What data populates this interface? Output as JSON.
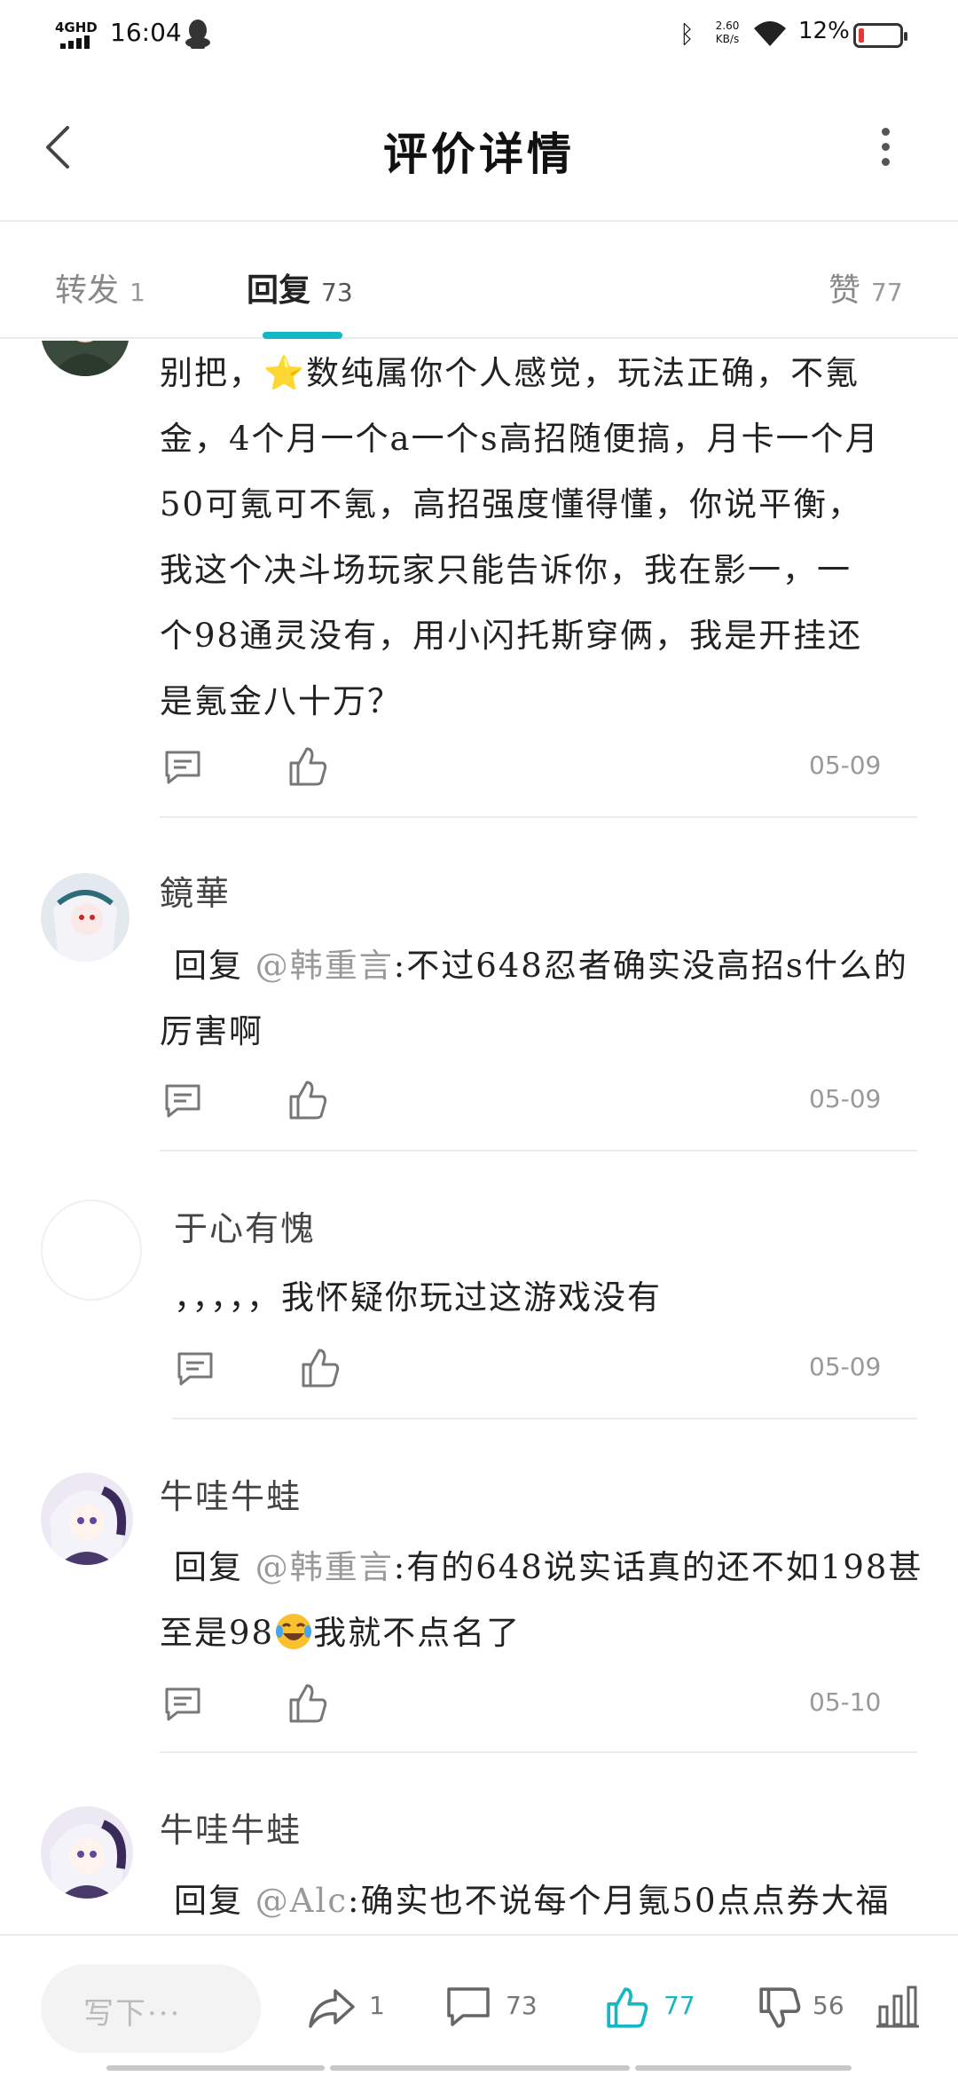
{
  "status_bar": {
    "network": "4GHD",
    "time": "16:04",
    "speed_value": "2.60",
    "speed_unit": "KB/s",
    "battery": "12%"
  },
  "header": {
    "title": "评价详情"
  },
  "tabs": [
    {
      "label": "转发",
      "count": "1"
    },
    {
      "label": "回复",
      "count": "73"
    },
    {
      "label": "赞",
      "count": "77"
    }
  ],
  "comments": [
    {
      "lines": [
        "别把，⭐数纯属你个人感觉，玩法正确，不氪",
        "金，4个月一个a一个s高招随便搞，月卡一个月",
        "50可氪可不氪，高招强度懂得懂，你说平衡，",
        "我这个决斗场玩家只能告诉你，我在影一，一",
        "个98通灵没有，用小闪托斯穿俩，我是开挂还",
        "是氪金八十万？"
      ],
      "date": "05-09"
    },
    {
      "name": "鏡華",
      "reply_prefix": "回复",
      "mention": "@韩重言",
      "lines": [
        ":不过648忍者确实没高招s什么的",
        "厉害啊"
      ],
      "date": "05-09"
    },
    {
      "name": "于心有愧",
      "lines": [
        "，，，，，我怀疑你玩过这游戏没有"
      ],
      "date": "05-09"
    },
    {
      "name": "牛哇牛蛙",
      "reply_prefix": "回复",
      "mention": "@韩重言",
      "lines": [
        ":有的648说实话真的还不如198甚",
        "至是98",
        "我就不点名了"
      ],
      "date": "05-10"
    },
    {
      "name": "牛哇牛蛙",
      "reply_prefix": "回复",
      "mention": "@Alc",
      "lines": [
        ":确实也不说每个月氪50点点券大福"
      ]
    }
  ],
  "bottom_bar": {
    "write_placeholder": "写下···",
    "share_count": "1",
    "comment_count": "73",
    "like_count": "77",
    "dislike_count": "56"
  },
  "colors": {
    "accent": "#14b8c3",
    "muted": "#999999",
    "divider": "#ececec"
  }
}
